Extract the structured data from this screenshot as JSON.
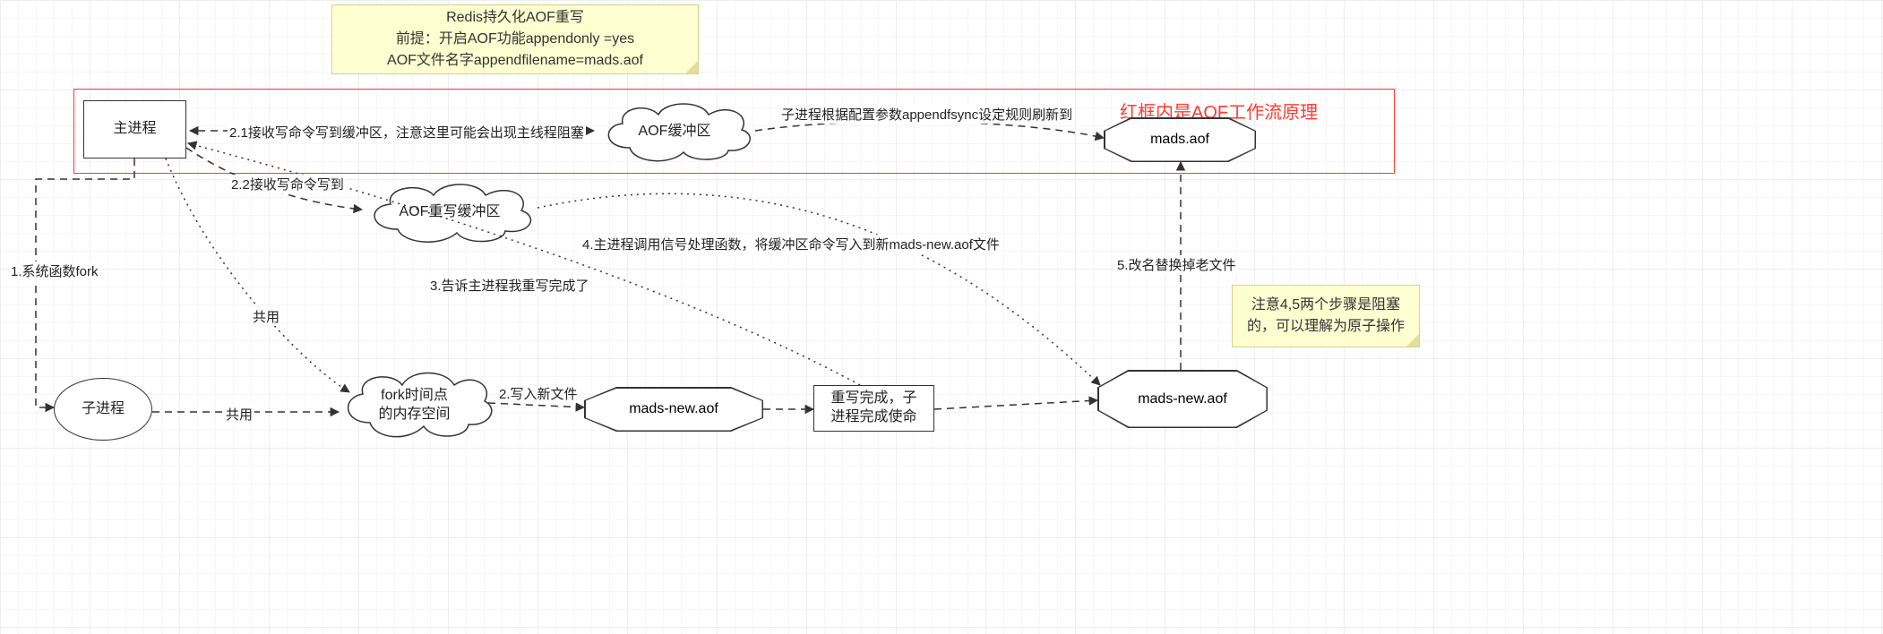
{
  "notes": {
    "top": {
      "line1": "Redis持久化AOF重写",
      "line2": "前提：开启AOF功能appendonly =yes",
      "line3": "AOF文件名字appendfilename=mads.aof"
    },
    "right": {
      "line1": "注意4,5两个步骤是阻塞",
      "line2": "的，可以理解为原子操作"
    }
  },
  "redboxLabel": "红框内是AOF工作流原理",
  "nodes": {
    "mainProcess": "主进程",
    "aofBuffer": "AOF缓冲区",
    "madsAof": "mads.aof",
    "aofRewriteBuffer": "AOF重写缓冲区",
    "childProcess": "子进程",
    "forkSnapshot_l1": "fork时间点",
    "forkSnapshot_l2": "的内存空间",
    "madsNew1": "mads-new.aof",
    "rewriteDone_l1": "重写完成，子",
    "rewriteDone_l2": "进程完成使命",
    "madsNew2": "mads-new.aof"
  },
  "edges": {
    "e1": "1.系统函数fork",
    "e21": "2.1接收写命令写到缓冲区，注意这里可能会出现主线程阻塞",
    "e22": "2.2接收写命令写到",
    "eFsync": "子进程根据配置参数appendfsync设定规则刷新到",
    "eShare1": "共用",
    "eShare2": "共用",
    "e2write": "2.写入新文件",
    "e3": "3.告诉主进程我重写完成了",
    "e4": "4.主进程调用信号处理函数，将缓冲区命令写入到新mads-new.aof文件",
    "e5": "5.改名替换掉老文件"
  }
}
